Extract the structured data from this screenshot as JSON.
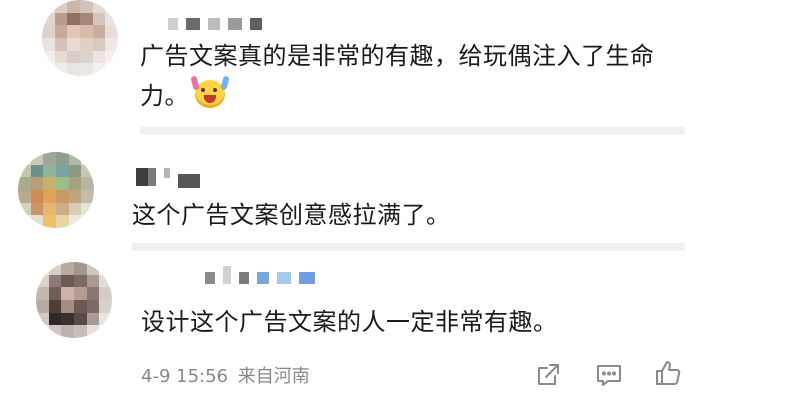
{
  "comments": [
    {
      "text": "广告文案真的是非常的有趣，给玩偶注入了生命力。",
      "emoji": "hands-up-emoji"
    },
    {
      "text": "这个广告文案创意感拉满了。"
    },
    {
      "text": "设计这个广告文案的人一定非常有趣。",
      "time": "4-9 15:56",
      "location": "来自河南"
    }
  ],
  "colors": {
    "accent": "#f5a623",
    "meta_text": "#888888",
    "divider": "#f0f0f0"
  },
  "icons": [
    "share-icon",
    "comment-icon",
    "like-icon"
  ]
}
